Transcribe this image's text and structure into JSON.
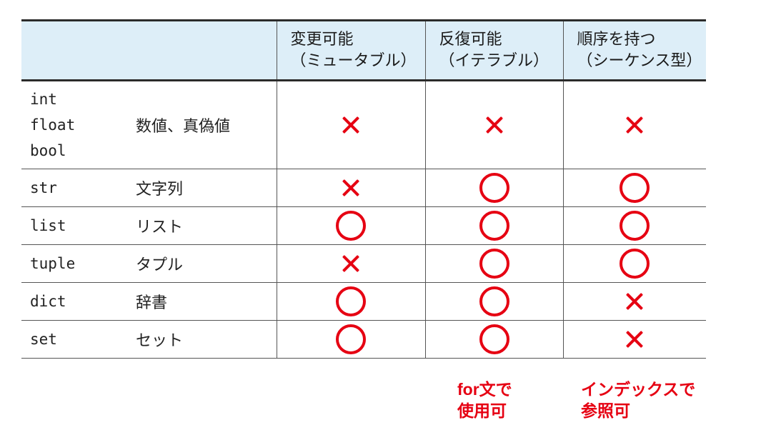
{
  "header": {
    "columns": [
      {
        "line1": "変更可能",
        "line2": "（ミュータブル）"
      },
      {
        "line1": "反復可能",
        "line2": "（イテラブル）"
      },
      {
        "line1": "順序を持つ",
        "line2": "（シーケンス型）"
      }
    ]
  },
  "rows": [
    {
      "types": [
        "int",
        "float",
        "bool"
      ],
      "desc": "数値、真偽値",
      "mutable": "cross",
      "iterable": "cross",
      "sequence": "cross"
    },
    {
      "types": [
        "str"
      ],
      "desc": "文字列",
      "mutable": "cross",
      "iterable": "circle",
      "sequence": "circle"
    },
    {
      "types": [
        "list"
      ],
      "desc": "リスト",
      "mutable": "circle",
      "iterable": "circle",
      "sequence": "circle"
    },
    {
      "types": [
        "tuple"
      ],
      "desc": "タプル",
      "mutable": "cross",
      "iterable": "circle",
      "sequence": "circle"
    },
    {
      "types": [
        "dict"
      ],
      "desc": "辞書",
      "mutable": "circle",
      "iterable": "circle",
      "sequence": "cross"
    },
    {
      "types": [
        "set"
      ],
      "desc": "セット",
      "mutable": "circle",
      "iterable": "circle",
      "sequence": "cross"
    }
  ],
  "notes": {
    "iterable": {
      "line1": "for文で",
      "line2": "使用可"
    },
    "sequence": {
      "line1": "インデックスで",
      "line2": "参照可"
    }
  },
  "colors": {
    "accent": "#e60012",
    "header_bg": "#ddeef8",
    "rule": "#2b2b2b"
  }
}
